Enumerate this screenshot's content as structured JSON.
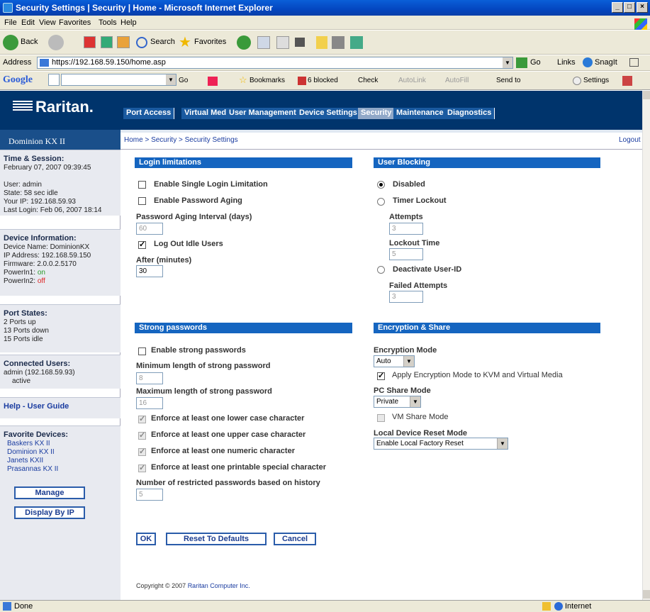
{
  "window": {
    "title": "Security Settings | Security | Home - Microsoft Internet Explorer"
  },
  "menu": [
    "File",
    "Edit",
    "View",
    "Favorites",
    "Tools",
    "Help"
  ],
  "toolbar": {
    "back": "Back",
    "search": "Search",
    "favorites": "Favorites"
  },
  "address": {
    "label": "Address",
    "url": "https://192.168.59.150/home.asp",
    "go": "Go",
    "links": "Links",
    "snagit": "SnagIt"
  },
  "googlebar": {
    "logo": "Google",
    "go": "Go",
    "bookmarks": "Bookmarks",
    "blocked": "6 blocked",
    "check": "Check",
    "autolink": "AutoLink",
    "autofill": "AutoFill",
    "sendto": "Send to",
    "settings": "Settings"
  },
  "brand": {
    "logo": "Raritan.",
    "product": "Dominion KX II"
  },
  "nav": {
    "tabs": [
      "Port Access",
      "Virtual Media",
      "User Management",
      "Device Settings",
      "Security",
      "Maintenance",
      "Diagnostics"
    ],
    "active": "Security"
  },
  "breadcrumb": {
    "text": "Home > Security > Security Settings",
    "logout": "Logout"
  },
  "sidebar": {
    "time_title": "Time & Session:",
    "time_value": "February 07, 2007 09:39:45",
    "user": "User: admin",
    "state": "State: 58 sec idle",
    "ip": "Your IP: 192.168.59.93",
    "last_login": "Last Login: Feb 06, 2007 18:14",
    "device_title": "Device Information:",
    "device_name": "Device Name: DominionKX",
    "device_ip": "IP Address: 192.168.59.150",
    "firmware": "Firmware: 2.0.0.2.5170",
    "power1_label": "PowerIn1:",
    "power1_value": "on",
    "power2_label": "PowerIn2:",
    "power2_value": "off",
    "ports_title": "Port States:",
    "ports_up": "2 Ports up",
    "ports_down": "13 Ports down",
    "ports_idle": "15 Ports idle",
    "users_title": "Connected Users:",
    "users_value": "admin (192.168.59.93)",
    "users_state": "active",
    "help": "Help - User Guide",
    "fav_title": "Favorite Devices:",
    "favorites": [
      "Baskers KX II",
      "Dominion KX II",
      "Janets KXII",
      "Prasannas KX II"
    ],
    "manage": "Manage",
    "display_by_ip": "Display By IP"
  },
  "login": {
    "header": "Login limitations",
    "single": "Enable Single Login Limitation",
    "aging": "Enable Password Aging",
    "aging_interval_label": "Password Aging Interval (days)",
    "aging_interval": "60",
    "logout_idle": "Log Out Idle Users",
    "after_label": "After (minutes)",
    "after": "30"
  },
  "blocking": {
    "header": "User Blocking",
    "disabled": "Disabled",
    "timer": "Timer Lockout",
    "attempts_label": "Attempts",
    "attempts": "3",
    "lockout_label": "Lockout Time",
    "lockout": "5",
    "deactivate": "Deactivate User-ID",
    "failed_label": "Failed Attempts",
    "failed": "3"
  },
  "strong": {
    "header": "Strong passwords",
    "enable": "Enable strong passwords",
    "min_label": "Minimum length of strong password",
    "min": "8",
    "max_label": "Maximum length of strong password",
    "max": "16",
    "lower": "Enforce at least one lower case character",
    "upper": "Enforce at least one upper case character",
    "numeric": "Enforce at least one numeric character",
    "special": "Enforce at least one printable special character",
    "history_label": "Number of restricted passwords based on history",
    "history": "5"
  },
  "encryption": {
    "header": "Encryption & Share",
    "mode_label": "Encryption Mode",
    "mode": "Auto",
    "apply": "Apply Encryption Mode to KVM and Virtual Media",
    "pc_share_label": "PC Share Mode",
    "pc_share": "Private",
    "vm_share": "VM Share Mode",
    "reset_label": "Local Device Reset Mode",
    "reset": "Enable Local Factory Reset"
  },
  "buttons": {
    "ok": "OK",
    "reset": "Reset To Defaults",
    "cancel": "Cancel"
  },
  "footer": {
    "prefix": "Copyright © 2007",
    "company": "Raritan Computer Inc."
  },
  "status": {
    "left": "Done",
    "zone": "Internet"
  }
}
